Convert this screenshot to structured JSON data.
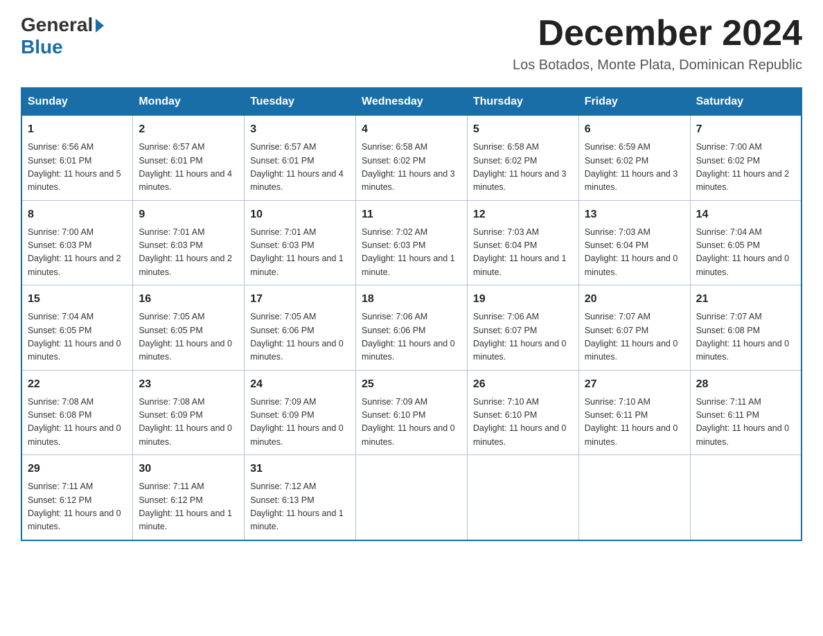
{
  "logo": {
    "text_general": "General",
    "text_blue": "Blue"
  },
  "title": "December 2024",
  "location": "Los Botados, Monte Plata, Dominican Republic",
  "days_of_week": [
    "Sunday",
    "Monday",
    "Tuesday",
    "Wednesday",
    "Thursday",
    "Friday",
    "Saturday"
  ],
  "weeks": [
    [
      {
        "day": "1",
        "sunrise": "Sunrise: 6:56 AM",
        "sunset": "Sunset: 6:01 PM",
        "daylight": "Daylight: 11 hours and 5 minutes."
      },
      {
        "day": "2",
        "sunrise": "Sunrise: 6:57 AM",
        "sunset": "Sunset: 6:01 PM",
        "daylight": "Daylight: 11 hours and 4 minutes."
      },
      {
        "day": "3",
        "sunrise": "Sunrise: 6:57 AM",
        "sunset": "Sunset: 6:01 PM",
        "daylight": "Daylight: 11 hours and 4 minutes."
      },
      {
        "day": "4",
        "sunrise": "Sunrise: 6:58 AM",
        "sunset": "Sunset: 6:02 PM",
        "daylight": "Daylight: 11 hours and 3 minutes."
      },
      {
        "day": "5",
        "sunrise": "Sunrise: 6:58 AM",
        "sunset": "Sunset: 6:02 PM",
        "daylight": "Daylight: 11 hours and 3 minutes."
      },
      {
        "day": "6",
        "sunrise": "Sunrise: 6:59 AM",
        "sunset": "Sunset: 6:02 PM",
        "daylight": "Daylight: 11 hours and 3 minutes."
      },
      {
        "day": "7",
        "sunrise": "Sunrise: 7:00 AM",
        "sunset": "Sunset: 6:02 PM",
        "daylight": "Daylight: 11 hours and 2 minutes."
      }
    ],
    [
      {
        "day": "8",
        "sunrise": "Sunrise: 7:00 AM",
        "sunset": "Sunset: 6:03 PM",
        "daylight": "Daylight: 11 hours and 2 minutes."
      },
      {
        "day": "9",
        "sunrise": "Sunrise: 7:01 AM",
        "sunset": "Sunset: 6:03 PM",
        "daylight": "Daylight: 11 hours and 2 minutes."
      },
      {
        "day": "10",
        "sunrise": "Sunrise: 7:01 AM",
        "sunset": "Sunset: 6:03 PM",
        "daylight": "Daylight: 11 hours and 1 minute."
      },
      {
        "day": "11",
        "sunrise": "Sunrise: 7:02 AM",
        "sunset": "Sunset: 6:03 PM",
        "daylight": "Daylight: 11 hours and 1 minute."
      },
      {
        "day": "12",
        "sunrise": "Sunrise: 7:03 AM",
        "sunset": "Sunset: 6:04 PM",
        "daylight": "Daylight: 11 hours and 1 minute."
      },
      {
        "day": "13",
        "sunrise": "Sunrise: 7:03 AM",
        "sunset": "Sunset: 6:04 PM",
        "daylight": "Daylight: 11 hours and 0 minutes."
      },
      {
        "day": "14",
        "sunrise": "Sunrise: 7:04 AM",
        "sunset": "Sunset: 6:05 PM",
        "daylight": "Daylight: 11 hours and 0 minutes."
      }
    ],
    [
      {
        "day": "15",
        "sunrise": "Sunrise: 7:04 AM",
        "sunset": "Sunset: 6:05 PM",
        "daylight": "Daylight: 11 hours and 0 minutes."
      },
      {
        "day": "16",
        "sunrise": "Sunrise: 7:05 AM",
        "sunset": "Sunset: 6:05 PM",
        "daylight": "Daylight: 11 hours and 0 minutes."
      },
      {
        "day": "17",
        "sunrise": "Sunrise: 7:05 AM",
        "sunset": "Sunset: 6:06 PM",
        "daylight": "Daylight: 11 hours and 0 minutes."
      },
      {
        "day": "18",
        "sunrise": "Sunrise: 7:06 AM",
        "sunset": "Sunset: 6:06 PM",
        "daylight": "Daylight: 11 hours and 0 minutes."
      },
      {
        "day": "19",
        "sunrise": "Sunrise: 7:06 AM",
        "sunset": "Sunset: 6:07 PM",
        "daylight": "Daylight: 11 hours and 0 minutes."
      },
      {
        "day": "20",
        "sunrise": "Sunrise: 7:07 AM",
        "sunset": "Sunset: 6:07 PM",
        "daylight": "Daylight: 11 hours and 0 minutes."
      },
      {
        "day": "21",
        "sunrise": "Sunrise: 7:07 AM",
        "sunset": "Sunset: 6:08 PM",
        "daylight": "Daylight: 11 hours and 0 minutes."
      }
    ],
    [
      {
        "day": "22",
        "sunrise": "Sunrise: 7:08 AM",
        "sunset": "Sunset: 6:08 PM",
        "daylight": "Daylight: 11 hours and 0 minutes."
      },
      {
        "day": "23",
        "sunrise": "Sunrise: 7:08 AM",
        "sunset": "Sunset: 6:09 PM",
        "daylight": "Daylight: 11 hours and 0 minutes."
      },
      {
        "day": "24",
        "sunrise": "Sunrise: 7:09 AM",
        "sunset": "Sunset: 6:09 PM",
        "daylight": "Daylight: 11 hours and 0 minutes."
      },
      {
        "day": "25",
        "sunrise": "Sunrise: 7:09 AM",
        "sunset": "Sunset: 6:10 PM",
        "daylight": "Daylight: 11 hours and 0 minutes."
      },
      {
        "day": "26",
        "sunrise": "Sunrise: 7:10 AM",
        "sunset": "Sunset: 6:10 PM",
        "daylight": "Daylight: 11 hours and 0 minutes."
      },
      {
        "day": "27",
        "sunrise": "Sunrise: 7:10 AM",
        "sunset": "Sunset: 6:11 PM",
        "daylight": "Daylight: 11 hours and 0 minutes."
      },
      {
        "day": "28",
        "sunrise": "Sunrise: 7:11 AM",
        "sunset": "Sunset: 6:11 PM",
        "daylight": "Daylight: 11 hours and 0 minutes."
      }
    ],
    [
      {
        "day": "29",
        "sunrise": "Sunrise: 7:11 AM",
        "sunset": "Sunset: 6:12 PM",
        "daylight": "Daylight: 11 hours and 0 minutes."
      },
      {
        "day": "30",
        "sunrise": "Sunrise: 7:11 AM",
        "sunset": "Sunset: 6:12 PM",
        "daylight": "Daylight: 11 hours and 1 minute."
      },
      {
        "day": "31",
        "sunrise": "Sunrise: 7:12 AM",
        "sunset": "Sunset: 6:13 PM",
        "daylight": "Daylight: 11 hours and 1 minute."
      },
      null,
      null,
      null,
      null
    ]
  ]
}
